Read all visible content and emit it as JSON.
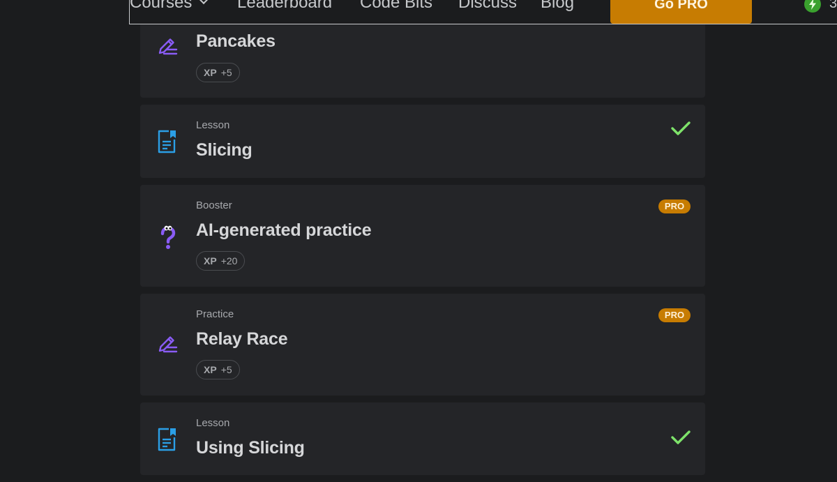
{
  "nav": {
    "items": [
      "Courses",
      "Leaderboard",
      "Code Bits",
      "Discuss",
      "Blog"
    ],
    "go_pro_label": "Go PRO",
    "streak_count": "3"
  },
  "cards": [
    {
      "kind": "",
      "title": "Pancakes",
      "icon": "pencil-icon",
      "xp_label": "XP",
      "xp_value": "+5"
    },
    {
      "kind": "Lesson",
      "title": "Slicing",
      "icon": "lesson-doc-icon",
      "completed": true
    },
    {
      "kind": "Booster",
      "title": "AI-generated practice",
      "icon": "question-mark-icon",
      "badge": "PRO",
      "xp_label": "XP",
      "xp_value": "+20"
    },
    {
      "kind": "Practice",
      "title": "Relay Race",
      "icon": "pencil-icon",
      "badge": "PRO",
      "xp_label": "XP",
      "xp_value": "+5"
    },
    {
      "kind": "Lesson",
      "title": "Using Slicing",
      "icon": "lesson-doc-icon",
      "completed": true
    }
  ],
  "colors": {
    "background": "#1b1c1e",
    "card": "#242528",
    "pro": "#c77c02",
    "check": "#7ee36a",
    "lesson_icon": "#2b9fe6",
    "practice_icon": "#8a5cf6"
  }
}
